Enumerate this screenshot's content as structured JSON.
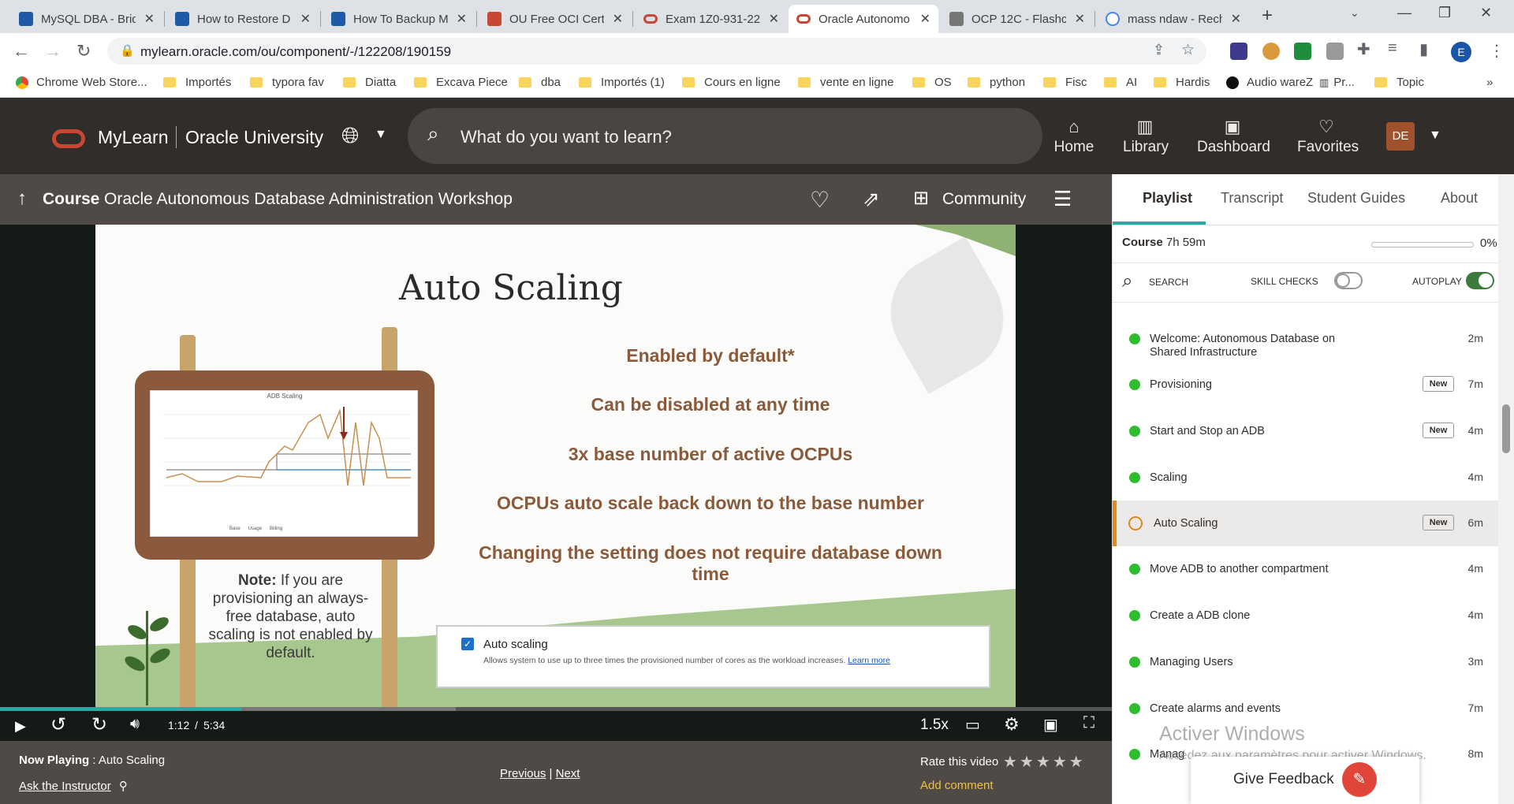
{
  "browser": {
    "tabs": [
      {
        "title": "MySQL DBA - Brid",
        "color": "#1e5aa8"
      },
      {
        "title": "How to Restore D",
        "color": "#1e5aa8"
      },
      {
        "title": "How To Backup M",
        "color": "#1e5aa8"
      },
      {
        "title": "OU Free OCI Cert",
        "color": "#c74634"
      },
      {
        "title": "Exam 1Z0-931-22",
        "color": "#c74634"
      },
      {
        "title": "Oracle Autonomo",
        "color": "#c74634"
      },
      {
        "title": "OCP 12C - Flashc",
        "color": "#777777"
      },
      {
        "title": "mass ndaw - Rech",
        "color": "#4285f4"
      }
    ],
    "url": "mylearn.oracle.com/ou/component/-/122208/190159",
    "profile_initial": "E",
    "bookmarks": [
      "Chrome Web Store...",
      "Importés",
      "typora fav",
      "Diatta",
      "Excava Piece",
      "dba",
      "Importés (1)",
      "Cours en ligne",
      "vente en ligne",
      "OS",
      "python",
      "Fisc",
      "AI",
      "Hardis",
      "Audio wareZ",
      "Pr...",
      "Topic"
    ]
  },
  "header": {
    "brand": "MyLearn",
    "brand_sub": "Oracle University",
    "search_placeholder": "What do you want to learn?",
    "nav": [
      {
        "label": "Home",
        "icon": "home-icon",
        "glyph": "⌂"
      },
      {
        "label": "Library",
        "icon": "library-icon",
        "glyph": "▥"
      },
      {
        "label": "Dashboard",
        "icon": "dashboard-icon",
        "glyph": "▣"
      },
      {
        "label": "Favorites",
        "icon": "heart-icon",
        "glyph": "♡"
      }
    ],
    "avatar": "DE"
  },
  "course": {
    "label": "Course",
    "title": "Oracle Autonomous Database Administration Workshop",
    "community": "Community"
  },
  "slide": {
    "title": "Auto Scaling",
    "bullets": [
      "Enabled by default*",
      "Can be disabled at any time",
      "3x base number of active OCPUs",
      "OCPUs auto scale back down to the base number",
      "Changing the setting does not require database down time"
    ],
    "note_bold": "Note:",
    "note": "If you are provisioning an always-free database, auto scaling is not enabled by default.",
    "chart_title": "ADB Scaling",
    "legend": [
      "Base",
      "Usage",
      "Billing"
    ],
    "checkbox_label": "Auto scaling",
    "checkbox_desc": "Allows system to use up to three times the provisioned number of cores as the workload increases.",
    "learn_more": "Learn more"
  },
  "player": {
    "current": "1:12",
    "separator": "/",
    "duration": "5:34",
    "speed": "1.5x",
    "progress_played": 0.217,
    "progress_buffered": 0.41
  },
  "now_playing": {
    "label": "Now Playing",
    "title": "Auto Scaling",
    "ask": "Ask the Instructor",
    "previous": "Previous",
    "separator": "|",
    "next": "Next",
    "rate": "Rate this video",
    "add_comment": "Add comment"
  },
  "panel": {
    "tabs": [
      "Playlist",
      "Transcript",
      "Student Guides",
      "About"
    ],
    "course_label": "Course",
    "course_duration": "7h 59m",
    "course_progress": "0%",
    "search": "SEARCH",
    "skill_checks": "SKILL CHECKS",
    "autoplay": "AUTOPLAY",
    "lessons": [
      {
        "title": "Welcome: Autonomous Database on Shared Infrastructure",
        "badge": "",
        "duration": "2m"
      },
      {
        "title": "Provisioning",
        "badge": "New",
        "duration": "7m"
      },
      {
        "title": "Start and Stop an ADB",
        "badge": "New",
        "duration": "4m"
      },
      {
        "title": "Scaling",
        "badge": "",
        "duration": "4m"
      },
      {
        "title": "Auto Scaling",
        "badge": "New",
        "duration": "6m"
      },
      {
        "title": "Move ADB to another compartment",
        "badge": "",
        "duration": "4m"
      },
      {
        "title": "Create a ADB clone",
        "badge": "",
        "duration": "4m"
      },
      {
        "title": "Managing Users",
        "badge": "",
        "duration": "3m"
      },
      {
        "title": "Create alarms and events",
        "badge": "",
        "duration": "7m"
      },
      {
        "title": "Manag",
        "badge": "",
        "duration": "8m"
      }
    ]
  },
  "overlay": {
    "watermark_title": "Activer Windows",
    "watermark_sub": "Accédez aux paramètres pour activer Windows.",
    "feedback": "Give Feedback"
  }
}
